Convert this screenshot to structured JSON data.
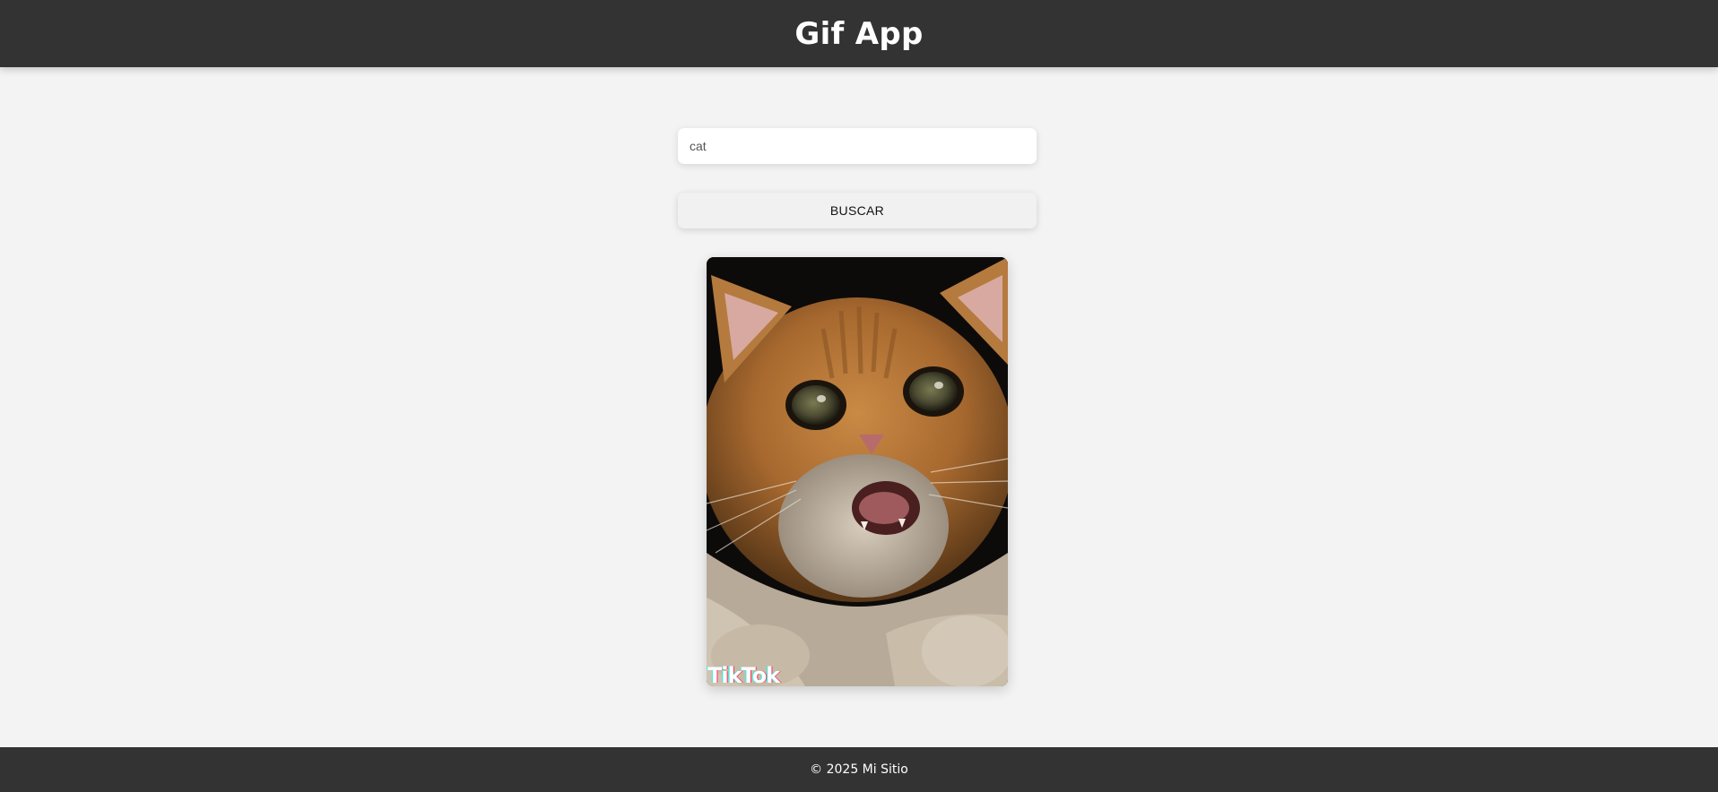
{
  "header": {
    "title": "Gif App"
  },
  "search": {
    "value": "cat",
    "placeholder": ""
  },
  "button": {
    "label": "BUSCAR"
  },
  "gifs": [
    {
      "watermark": "TikTok",
      "icon": "cat-gif-image"
    }
  ],
  "footer": {
    "text": "© 2025 Mi Sitio"
  },
  "colors": {
    "header_bg": "#333333",
    "page_bg": "#f3f3f3",
    "footer_bg": "#333333",
    "button_bg": "#f1f1f1"
  }
}
